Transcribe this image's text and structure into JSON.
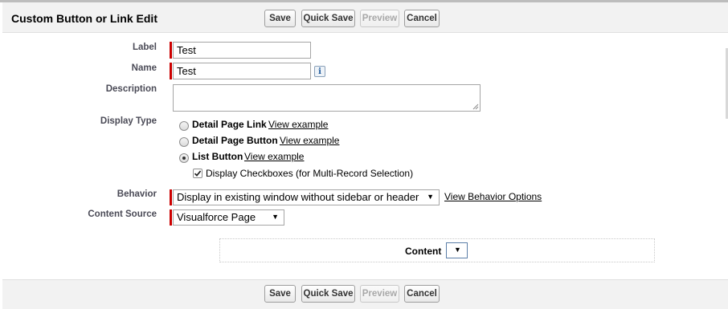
{
  "page": {
    "title": "Custom Button or Link Edit"
  },
  "toolbar": {
    "save_label": "Save",
    "quick_save_label": "Quick Save",
    "preview_label": "Preview",
    "cancel_label": "Cancel"
  },
  "form": {
    "label_field": {
      "label": "Label",
      "value": "Test"
    },
    "name_field": {
      "label": "Name",
      "value": "Test",
      "info_icon": "i"
    },
    "description_field": {
      "label": "Description",
      "value": ""
    },
    "display_type": {
      "label": "Display Type",
      "options": [
        {
          "label": "Detail Page Link",
          "link": "View example",
          "selected": false
        },
        {
          "label": "Detail Page Button",
          "link": "View example",
          "selected": false
        },
        {
          "label": "List Button",
          "link": "View example",
          "selected": true
        }
      ],
      "checkbox": {
        "label": "Display Checkboxes (for Multi-Record Selection)",
        "checked": true
      }
    },
    "behavior": {
      "label": "Behavior",
      "value": "Display in existing window without sidebar or header",
      "link": "View Behavior Options"
    },
    "content_source": {
      "label": "Content Source",
      "value": "Visualforce Page"
    },
    "content": {
      "label": "Content",
      "value": ""
    }
  },
  "icons": {
    "dropdown_arrow": "▼",
    "info": "info-icon",
    "checkmark": "checkmark-icon"
  },
  "colors": {
    "required": "#cc0000",
    "header_bg": "#f2f2f2",
    "label_text": "#4a4a56"
  }
}
